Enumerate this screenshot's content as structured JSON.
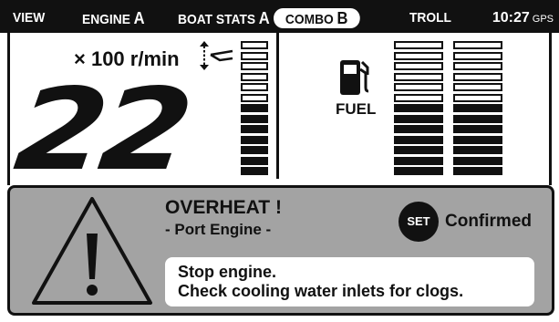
{
  "nav": {
    "tabs": [
      {
        "label": "VIEW",
        "suffix": ""
      },
      {
        "label": "ENGINE",
        "suffix": "A"
      },
      {
        "label": "BOAT STATS",
        "suffix": "A"
      },
      {
        "label": "COMBO",
        "suffix": "B"
      },
      {
        "label": "TROLL",
        "suffix": ""
      }
    ],
    "active_tab": "COMBO B",
    "clock": "10:27",
    "gps_label": "GPS"
  },
  "tachometer": {
    "unit_label": "× 100 r/min",
    "value": "22",
    "icon": "trim-icon",
    "trim_segments_total": 13,
    "trim_segments_filled": 7
  },
  "fuel": {
    "label": "FUEL",
    "icon": "fuel-pump-icon",
    "tanks": [
      {
        "segments_total": 13,
        "segments_filled": 7
      },
      {
        "segments_total": 13,
        "segments_filled": 7
      }
    ]
  },
  "alert": {
    "icon": "warning-triangle-icon",
    "title": "OVERHEAT !",
    "subtitle": "- Port Engine -",
    "set_button": "SET",
    "status": "Confirmed",
    "message_line1": "Stop engine.",
    "message_line2": "Check cooling water inlets for clogs."
  },
  "colors": {
    "background": "#ffffff",
    "bar": "#111111",
    "alert_panel": "#a3a3a3"
  }
}
